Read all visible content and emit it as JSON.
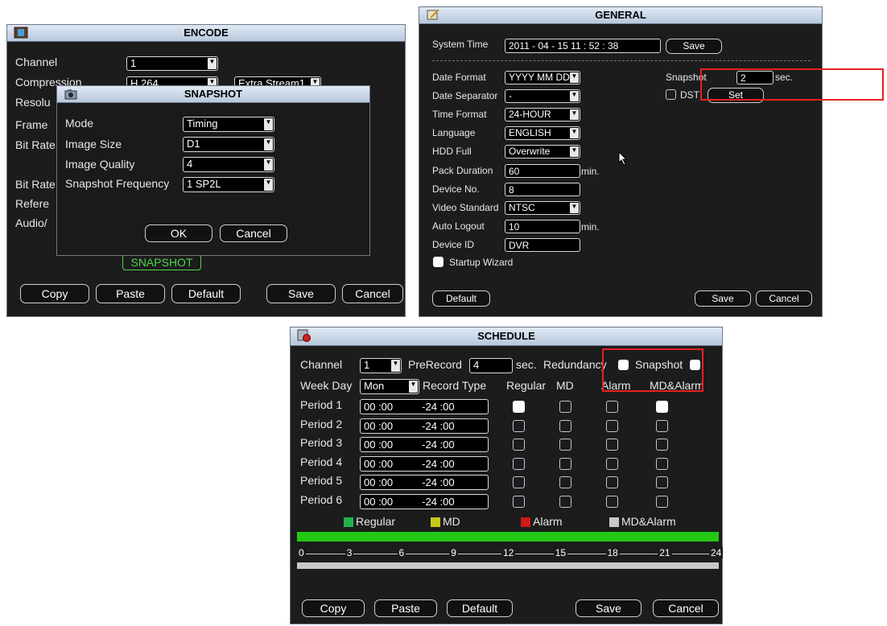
{
  "encode": {
    "title": "ENCODE",
    "labels": [
      "Channel",
      "Compression",
      "Resolu",
      "Frame",
      "Bit Rate",
      "Bit Rate",
      "Refere",
      "Audio/"
    ],
    "channel_value": "1",
    "compression_value": "H.264",
    "stream_value": "Extra Stream1",
    "snapshot_button": "SNAPSHOT",
    "buttons": {
      "copy": "Copy",
      "paste": "Paste",
      "default": "Default",
      "save": "Save",
      "cancel": "Cancel"
    }
  },
  "snapshot": {
    "title": "SNAPSHOT",
    "mode_label": "Mode",
    "mode_value": "Timing",
    "size_label": "Image Size",
    "size_value": "D1",
    "quality_label": "Image Quality",
    "quality_value": "4",
    "freq_label": "Snapshot Frequency",
    "freq_value": "1 SP2L",
    "ok": "OK",
    "cancel": "Cancel"
  },
  "general": {
    "title": "GENERAL",
    "system_time_label": "System Time",
    "system_time_value": "2011 - 04 - 15  11 : 52 : 38",
    "save_time": "Save",
    "date_format_label": "Date Format",
    "date_format_value": "YYYY MM DD",
    "date_sep_label": "Date Separator",
    "date_sep_value": "-",
    "time_format_label": "Time Format",
    "time_format_value": "24-HOUR",
    "language_label": "Language",
    "language_value": "ENGLISH",
    "hdd_full_label": "HDD Full",
    "hdd_full_value": "Overwrite",
    "pack_label": "Pack Duration",
    "pack_value": "60",
    "pack_unit": "min.",
    "device_no_label": "Device No.",
    "device_no_value": "8",
    "video_std_label": "Video Standard",
    "video_std_value": "NTSC",
    "auto_logout_label": "Auto Logout",
    "auto_logout_value": "10",
    "auto_logout_unit": "min.",
    "device_id_label": "Device ID",
    "device_id_value": "DVR",
    "startup_label": "Startup Wizard",
    "snapshot_label": "Snapshot",
    "snapshot_value": "2",
    "snapshot_unit": "sec.",
    "dst_label": "DST",
    "set": "Set",
    "default": "Default",
    "save": "Save",
    "cancel": "Cancel"
  },
  "schedule": {
    "title": "SCHEDULE",
    "channel_label": "Channel",
    "channel_value": "1",
    "prerecord_label": "PreRecord",
    "prerecord_value": "4",
    "prerecord_unit": "sec.",
    "redundancy_label": "Redundancy",
    "snapshot_label": "Snapshot",
    "weekday_label": "Week Day",
    "weekday_value": "Mon",
    "record_type_label": "Record Type",
    "col_regular": "Regular",
    "col_md": "MD",
    "col_alarm": "Alarm",
    "col_mdalarm": "MD&Alarm",
    "periods": [
      {
        "label": "Period 1",
        "start": "00 :00",
        "end": "-24 :00",
        "regular": true,
        "md": false,
        "alarm": false,
        "mdalarm": true
      },
      {
        "label": "Period 2",
        "start": "00 :00",
        "end": "-24 :00",
        "regular": false,
        "md": false,
        "alarm": false,
        "mdalarm": false
      },
      {
        "label": "Period 3",
        "start": "00 :00",
        "end": "-24 :00",
        "regular": false,
        "md": false,
        "alarm": false,
        "mdalarm": false
      },
      {
        "label": "Period 4",
        "start": "00 :00",
        "end": "-24 :00",
        "regular": false,
        "md": false,
        "alarm": false,
        "mdalarm": false
      },
      {
        "label": "Period 5",
        "start": "00 :00",
        "end": "-24 :00",
        "regular": false,
        "md": false,
        "alarm": false,
        "mdalarm": false
      },
      {
        "label": "Period 6",
        "start": "00 :00",
        "end": "-24 :00",
        "regular": false,
        "md": false,
        "alarm": false,
        "mdalarm": false
      }
    ],
    "legend": [
      {
        "label": "Regular",
        "color": "#22b14c"
      },
      {
        "label": "MD",
        "color": "#c8c818"
      },
      {
        "label": "Alarm",
        "color": "#d01818"
      },
      {
        "label": "MD&Alarm",
        "color": "#c8c8c8"
      }
    ],
    "timeline_hours": [
      "0",
      "3",
      "6",
      "9",
      "12",
      "15",
      "18",
      "21",
      "24"
    ],
    "bar_color": "#22c814",
    "buttons": {
      "copy": "Copy",
      "paste": "Paste",
      "default": "Default",
      "save": "Save",
      "cancel": "Cancel"
    }
  }
}
